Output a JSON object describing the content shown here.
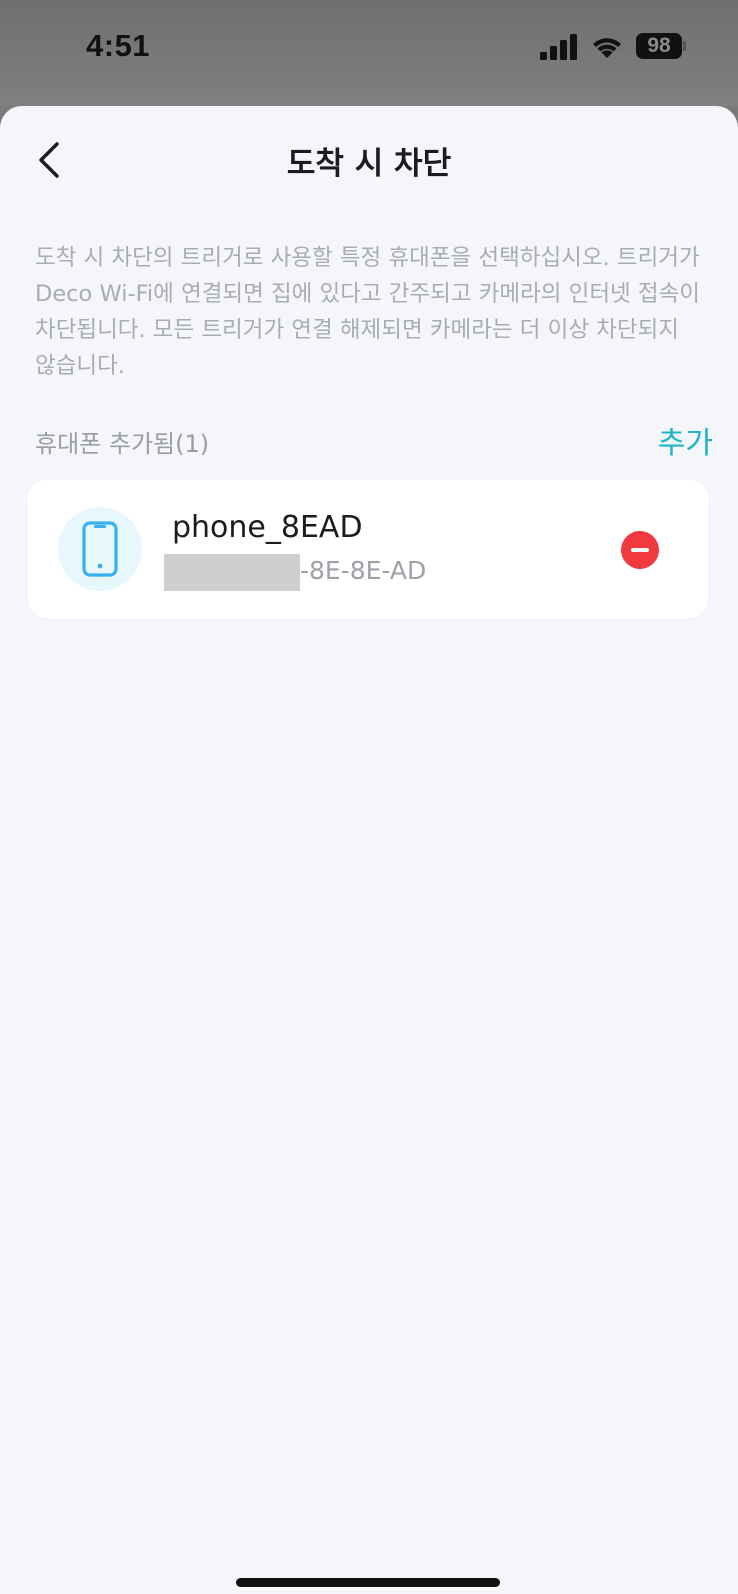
{
  "status_bar": {
    "time": "4:51",
    "battery_level": "98",
    "icons": [
      "cellular-signal-icon",
      "wifi-icon",
      "battery-icon"
    ]
  },
  "header": {
    "title": "도착 시 차단",
    "back_icon": "chevron-left-icon"
  },
  "description": "도착 시 차단의 트리거로 사용할 특정 휴대폰을 선택하십시오. 트리거가 Deco Wi-Fi에 연결되면 집에 있다고 간주되고 카메라의 인터넷 접속이 차단됩니다. 모든 트리거가 연결 해제되면 카메라는 더 이상 차단되지 않습니다.",
  "section": {
    "label": "휴대폰 추가됨(1)",
    "add_label": "추가"
  },
  "devices": [
    {
      "name": "phone_8EAD",
      "mac_visible": "-8E-8E-AD",
      "icon": "smartphone-icon",
      "remove_icon": "remove-circle-icon"
    }
  ],
  "colors": {
    "accent": "#1fb5c8",
    "remove": "#f03a3f",
    "background": "#f4f6fa",
    "card": "#ffffff",
    "icon_blue": "#3ab0f0",
    "icon_bg": "#e6f8fc"
  }
}
